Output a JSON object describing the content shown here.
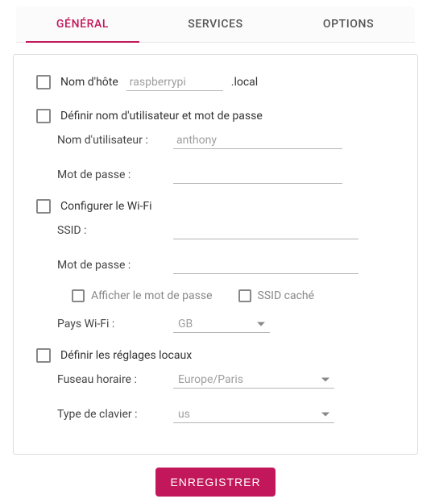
{
  "tabs": {
    "general": "GÉNÉRAL",
    "services": "SERVICES",
    "options": "OPTIONS"
  },
  "hostname": {
    "label": "Nom d'hôte",
    "placeholder": "raspberrypi",
    "suffix": ".local"
  },
  "userpass": {
    "label": "Définir nom d'utilisateur et mot de passe",
    "username_label": "Nom d'utilisateur :",
    "username_value": "anthony",
    "password_label": "Mot de passe :"
  },
  "wifi": {
    "label": "Configurer le Wi-Fi",
    "ssid_label": "SSID :",
    "password_label": "Mot de passe :",
    "show_pw": "Afficher le mot de passe",
    "hidden_ssid": "SSID caché",
    "country_label": "Pays Wi-Fi :",
    "country_value": "GB"
  },
  "locale": {
    "label": "Définir les réglages locaux",
    "tz_label": "Fuseau horaire :",
    "tz_value": "Europe/Paris",
    "kb_label": "Type de clavier :",
    "kb_value": "us"
  },
  "save_label": "ENREGISTRER"
}
